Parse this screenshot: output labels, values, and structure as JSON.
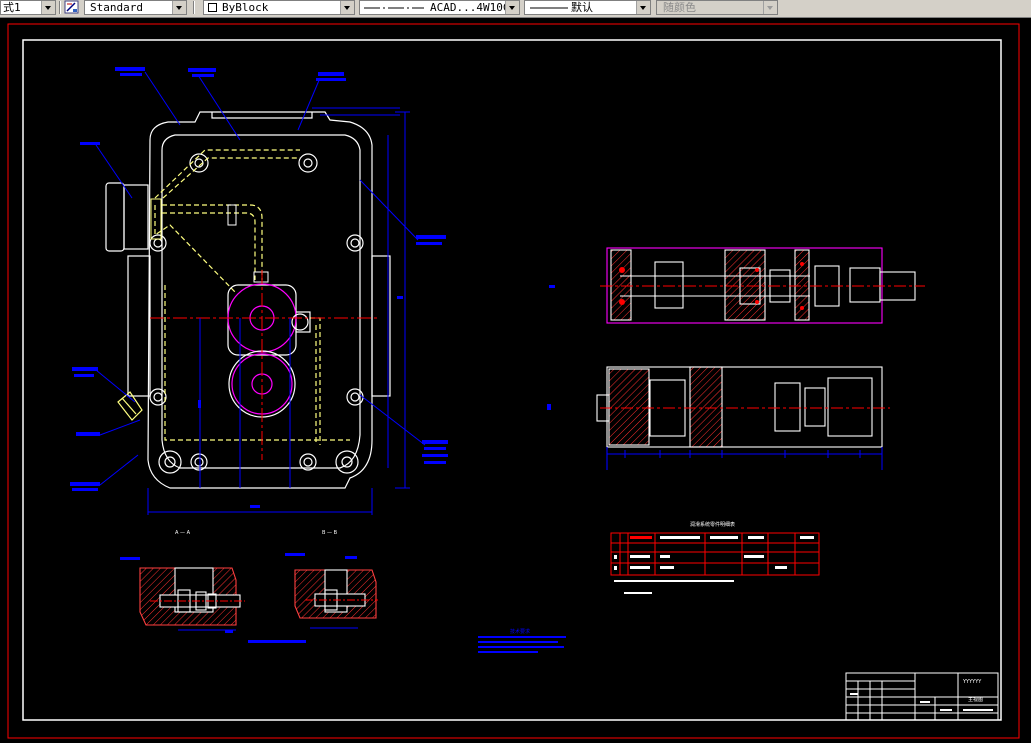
{
  "toolbar": {
    "text_style": "式1",
    "dim_style": "Standard",
    "layer_color": "ByBlock",
    "linetype": "ACAD...4W10C",
    "lineweight": "默认",
    "plot_style": "随颜色"
  },
  "drawing": {
    "section_label_1": "A — A",
    "section_label_2": "B — B",
    "table_title": "润滑系统零件明细表",
    "notes_title": "技术要求",
    "title_block_code": "YYYYYY",
    "title_block_name": "主视图"
  },
  "colors": {
    "frame": "#ff0000",
    "border": "#ffffff",
    "dimension": "#0000ff",
    "centerline": "#ff00ff",
    "hidden": "#ffff80",
    "geometry": "#ffffff"
  }
}
